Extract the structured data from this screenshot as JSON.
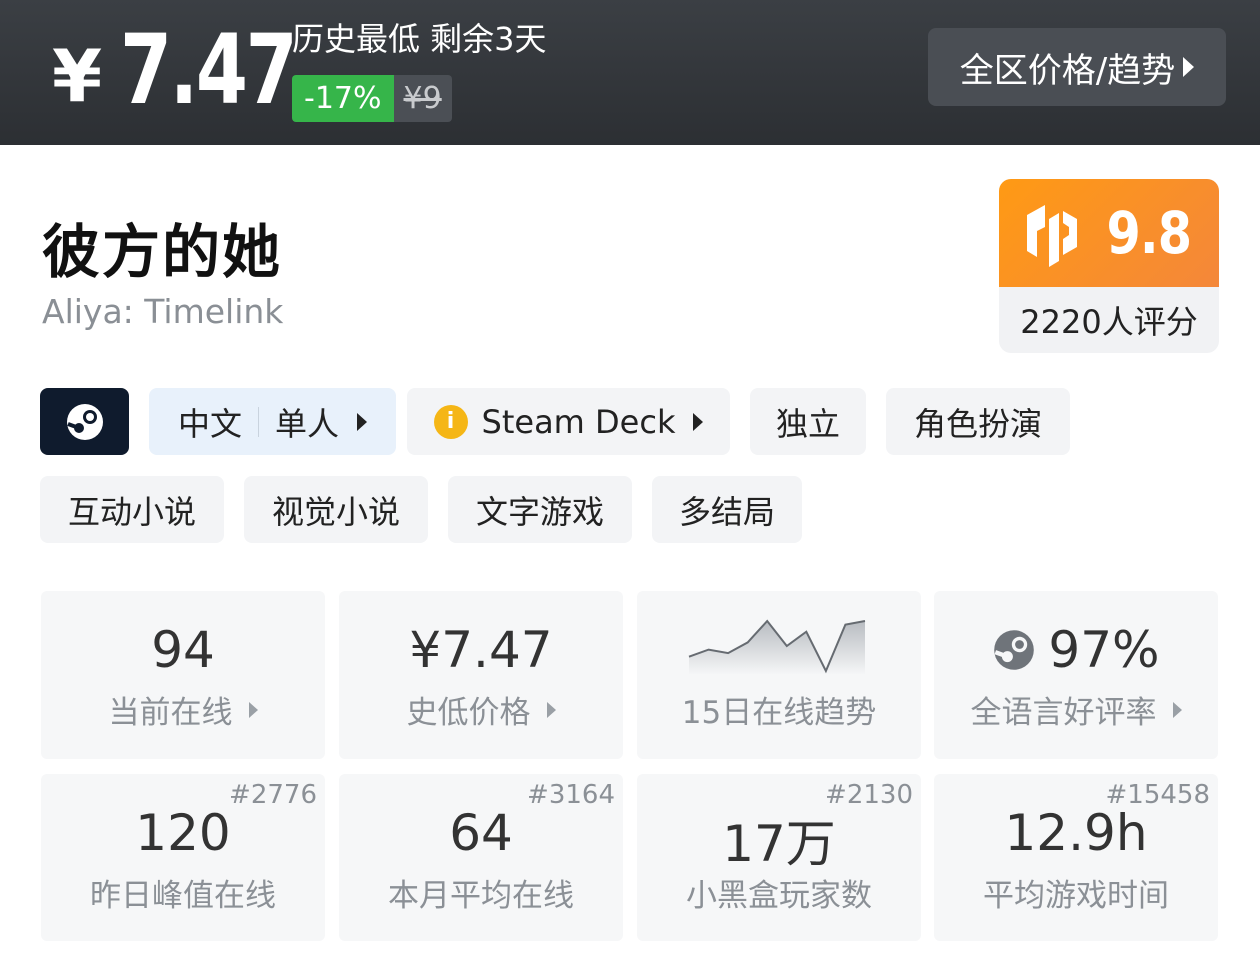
{
  "header": {
    "currency": "¥",
    "price": "7.47",
    "lowest_label": "历史最低 剩余3天",
    "discount": "-17%",
    "original_price": "¥9",
    "region_button": "全区价格/趋势"
  },
  "game": {
    "title": "彼方的她",
    "subtitle": "Aliya: Timelink",
    "score": "9.8",
    "rating_count": "2220人评分"
  },
  "tags": {
    "lang": "中文",
    "mode": "单人",
    "steam_deck": "Steam Deck",
    "genre_tags": [
      "独立",
      "角色扮演",
      "互动小说",
      "视觉小说",
      "文字游戏",
      "多结局"
    ]
  },
  "stats": {
    "current_online": {
      "value": "94",
      "label": "当前在线"
    },
    "lowest_price": {
      "value": "¥7.47",
      "label": "史低价格"
    },
    "trend": {
      "label": "15日在线趋势",
      "points": [
        12,
        14,
        13,
        16,
        22,
        15,
        19,
        8,
        21,
        22
      ]
    },
    "positive_rate": {
      "value": "97%",
      "label": "全语言好评率"
    },
    "peak_yesterday": {
      "value": "120",
      "label": "昨日峰值在线",
      "rank": "#2776"
    },
    "monthly_avg": {
      "value": "64",
      "label": "本月平均在线",
      "rank": "#3164"
    },
    "players": {
      "value": "17万",
      "label": "小黑盒玩家数",
      "rank": "#2130"
    },
    "avg_playtime": {
      "value": "12.9h",
      "label": "平均游戏时间",
      "rank": "#15458"
    }
  },
  "colors": {
    "discount_green": "#36b54a",
    "score_orange": "#ff9a14",
    "steam_dark": "#0f1b2d"
  }
}
